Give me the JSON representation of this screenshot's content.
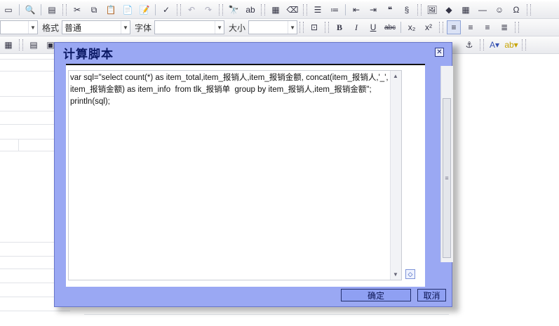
{
  "toolbar": {
    "format_label": "格式",
    "format_value": "普通",
    "font_label": "字体",
    "font_value": "",
    "size_label": "大小",
    "size_value": "",
    "bold": "B",
    "italic": "I",
    "underline": "U",
    "strike": "abc",
    "subscript": "x₂",
    "superscript": "x²"
  },
  "dialog": {
    "title": "计算脚本",
    "close_glyph": "✕",
    "code": "var sql=\"select count(*) as item_total,item_报销人,item_报销金额, concat(item_报销人,'_',item_报销金额) as item_info  from tlk_报销单  group by item_报销人,item_报销金额\";\nprintln(sql);",
    "ok_label": "确定",
    "cancel_label": "取消"
  },
  "colors": {
    "dialog_bg": "#9aa8f3",
    "title_text": "#0c1a66",
    "button_bg": "#8fa0f3"
  }
}
